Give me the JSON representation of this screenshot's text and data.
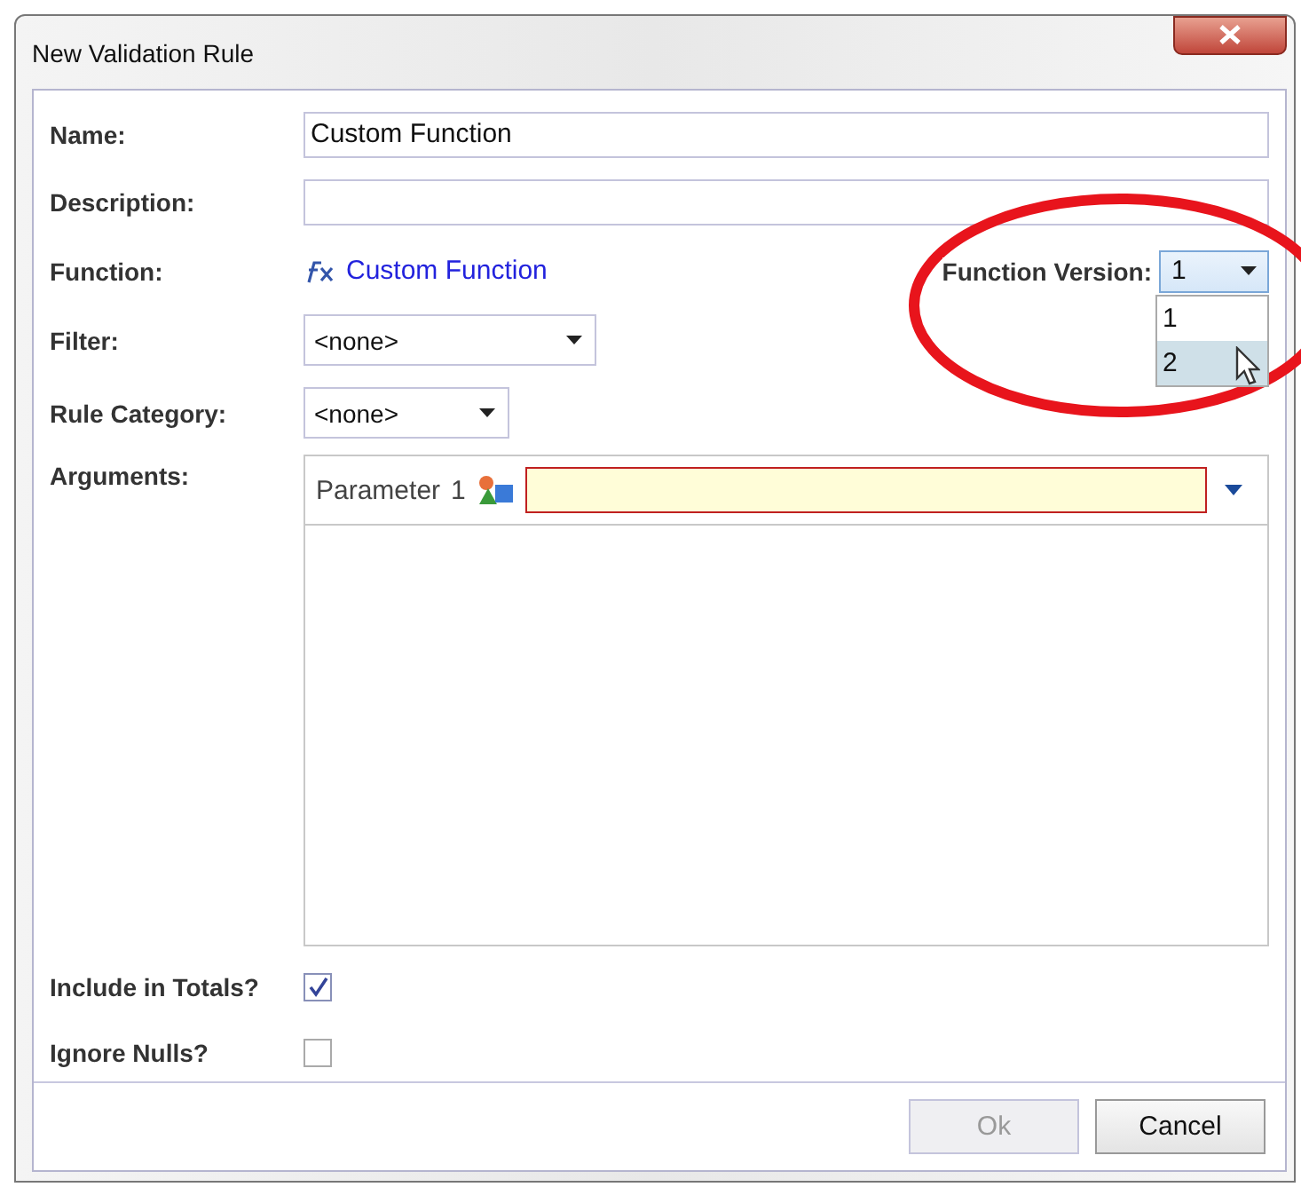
{
  "window": {
    "title": "New Validation Rule"
  },
  "form": {
    "name": {
      "label": "Name:",
      "value": "Custom Function"
    },
    "description": {
      "label": "Description:"
    },
    "function": {
      "label": "Function:",
      "link": "Custom Function"
    },
    "function_version": {
      "label": "Function Version:",
      "value": "1",
      "expanded": true,
      "options": [
        {
          "label": "1",
          "highlighted": false
        },
        {
          "label": "2",
          "highlighted": true
        }
      ]
    },
    "filter": {
      "label": "Filter:",
      "value": "<none>"
    },
    "rule_category": {
      "label": "Rule Category:",
      "value": "<none>"
    },
    "arguments": {
      "label": "Arguments:",
      "parameter": {
        "label": "Parameter",
        "index": "1",
        "invalid": true
      }
    },
    "checkboxes": [
      {
        "label": "Include in Totals?",
        "checked": true
      },
      {
        "label": "Ignore Nulls?",
        "checked": false
      }
    ]
  },
  "buttons": [
    {
      "label": "Ok",
      "disabled": true
    },
    {
      "label": "Cancel",
      "disabled": false
    }
  ]
}
